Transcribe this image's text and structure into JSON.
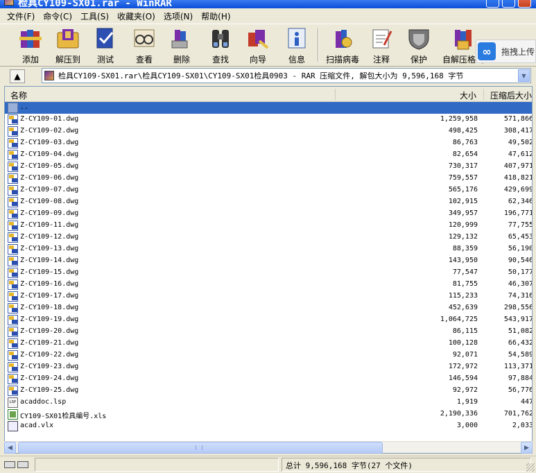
{
  "window": {
    "title": "检具CY109-SX01.rar - WinRAR"
  },
  "menu": [
    "文件(F)",
    "命令(C)",
    "工具(S)",
    "收藏夹(O)",
    "选项(N)",
    "帮助(H)"
  ],
  "toolbar": {
    "buttons": [
      {
        "label": "添加",
        "icon": "books-add-icon"
      },
      {
        "label": "解压到",
        "icon": "folder-extract-icon"
      },
      {
        "label": "测试",
        "icon": "test-icon"
      },
      {
        "label": "查看",
        "icon": "glasses-view-icon"
      },
      {
        "label": "删除",
        "icon": "delete-books-icon"
      },
      {
        "label": "查找",
        "icon": "binoculars-find-icon"
      },
      {
        "label": "向导",
        "icon": "wizard-icon"
      },
      {
        "label": "信息",
        "icon": "info-icon"
      },
      {
        "label": "扫描病毒",
        "icon": "virus-scan-icon"
      },
      {
        "label": "注释",
        "icon": "comment-icon"
      },
      {
        "label": "保护",
        "icon": "shield-protect-icon"
      },
      {
        "label": "自解压格式",
        "icon": "sfx-icon"
      }
    ],
    "cloud_label": "拖拽上传"
  },
  "address": {
    "text": "检具CY109-SX01.rar\\检具CY109-SX01\\CY109-SX01检具0903 - RAR 压缩文件, 解包大小为 9,596,168 字节"
  },
  "columns": {
    "name": "名称",
    "size": "大小",
    "packed": "压缩后大小"
  },
  "files": [
    {
      "name": "..",
      "size": "",
      "packed": "",
      "type": "folder"
    },
    {
      "name": "Z-CY109-01.dwg",
      "size": "1,259,958",
      "packed": "571,866",
      "type": "dwg"
    },
    {
      "name": "Z-CY109-02.dwg",
      "size": "498,425",
      "packed": "308,417",
      "type": "dwg"
    },
    {
      "name": "Z-CY109-03.dwg",
      "size": "86,763",
      "packed": "49,502",
      "type": "dwg"
    },
    {
      "name": "Z-CY109-04.dwg",
      "size": "82,654",
      "packed": "47,612",
      "type": "dwg"
    },
    {
      "name": "Z-CY109-05.dwg",
      "size": "730,317",
      "packed": "407,971",
      "type": "dwg"
    },
    {
      "name": "Z-CY109-06.dwg",
      "size": "759,557",
      "packed": "418,821",
      "type": "dwg"
    },
    {
      "name": "Z-CY109-07.dwg",
      "size": "565,176",
      "packed": "429,699",
      "type": "dwg"
    },
    {
      "name": "Z-CY109-08.dwg",
      "size": "102,915",
      "packed": "62,346",
      "type": "dwg"
    },
    {
      "name": "Z-CY109-09.dwg",
      "size": "349,957",
      "packed": "196,771",
      "type": "dwg"
    },
    {
      "name": "Z-CY109-11.dwg",
      "size": "120,999",
      "packed": "77,755",
      "type": "dwg"
    },
    {
      "name": "Z-CY109-12.dwg",
      "size": "129,132",
      "packed": "65,453",
      "type": "dwg"
    },
    {
      "name": "Z-CY109-13.dwg",
      "size": "88,359",
      "packed": "56,190",
      "type": "dwg"
    },
    {
      "name": "Z-CY109-14.dwg",
      "size": "143,950",
      "packed": "90,546",
      "type": "dwg"
    },
    {
      "name": "Z-CY109-15.dwg",
      "size": "77,547",
      "packed": "50,177",
      "type": "dwg"
    },
    {
      "name": "Z-CY109-16.dwg",
      "size": "81,755",
      "packed": "46,307",
      "type": "dwg"
    },
    {
      "name": "Z-CY109-17.dwg",
      "size": "115,233",
      "packed": "74,316",
      "type": "dwg"
    },
    {
      "name": "Z-CY109-18.dwg",
      "size": "452,639",
      "packed": "298,556",
      "type": "dwg"
    },
    {
      "name": "Z-CY109-19.dwg",
      "size": "1,064,725",
      "packed": "543,917",
      "type": "dwg"
    },
    {
      "name": "Z-CY109-20.dwg",
      "size": "86,115",
      "packed": "51,082",
      "type": "dwg"
    },
    {
      "name": "Z-CY109-21.dwg",
      "size": "100,128",
      "packed": "66,432",
      "type": "dwg"
    },
    {
      "name": "Z-CY109-22.dwg",
      "size": "92,071",
      "packed": "54,589",
      "type": "dwg"
    },
    {
      "name": "Z-CY109-23.dwg",
      "size": "172,972",
      "packed": "113,371",
      "type": "dwg"
    },
    {
      "name": "Z-CY109-24.dwg",
      "size": "146,594",
      "packed": "97,884",
      "type": "dwg"
    },
    {
      "name": "Z-CY109-25.dwg",
      "size": "92,972",
      "packed": "56,776",
      "type": "dwg"
    },
    {
      "name": "acaddoc.lsp",
      "size": "1,919",
      "packed": "447",
      "type": "lsp"
    },
    {
      "name": "CY109-SX01检具编号.xls",
      "size": "2,190,336",
      "packed": "701,762",
      "type": "xls"
    },
    {
      "name": "acad.vlx",
      "size": "3,000",
      "packed": "2,033",
      "type": "vlx"
    }
  ],
  "status": {
    "text": "总计 9,596,168 字节(27 个文件)"
  },
  "colors": {
    "selection": "#316ac5",
    "titlebar": "#0a4fd8",
    "window_bg": "#ECE9D8"
  }
}
